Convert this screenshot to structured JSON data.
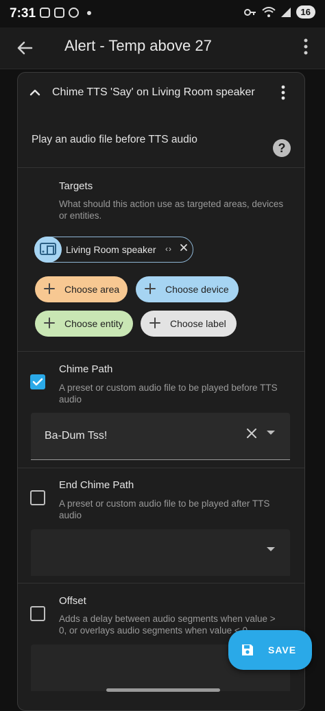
{
  "status_bar": {
    "time": "7:31",
    "battery": "16"
  },
  "app_bar": {
    "title": "Alert - Temp above 27"
  },
  "card": {
    "title": "Chime TTS 'Say' on Living Room speaker",
    "description": "Play an audio file before TTS audio",
    "help": "?"
  },
  "targets": {
    "title": "Targets",
    "subtitle": "What should this action use as targeted areas, devices or entities.",
    "selected": {
      "label": "Living Room speaker",
      "code": "‹›"
    },
    "buttons": [
      {
        "label": "Choose area",
        "color": "#f7c892"
      },
      {
        "label": "Choose device",
        "color": "#a6d4f2"
      },
      {
        "label": "Choose entity",
        "color": "#c9e6b4"
      },
      {
        "label": "Choose label",
        "color": "#e3e3e3"
      }
    ]
  },
  "chime_path": {
    "title": "Chime Path",
    "subtitle": "A preset or custom audio file to be played before TTS audio",
    "checked": true,
    "value": "Ba-Dum Tss!"
  },
  "end_chime_path": {
    "title": "End Chime Path",
    "subtitle": "A preset or custom audio file to be played after TTS audio",
    "checked": false,
    "value": ""
  },
  "offset": {
    "title": "Offset",
    "subtitle": "Adds a delay between audio segments when value > 0, or overlays audio segments when value < 0",
    "checked": false
  },
  "save_button": {
    "label": "SAVE"
  },
  "colors": {
    "accent": "#2aa9e8",
    "background": "#111111",
    "card": "#1e1e1e"
  }
}
